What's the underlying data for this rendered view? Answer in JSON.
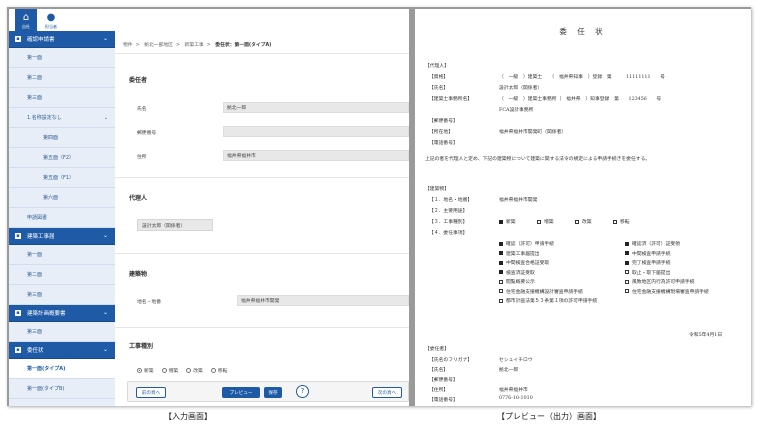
{
  "topbar": {
    "home_label": "自社",
    "user_label": "担当者"
  },
  "sidebar": {
    "groups": [
      {
        "title": "確認申請書",
        "items": [
          {
            "label": "第一面",
            "level": 1
          },
          {
            "label": "第二面",
            "level": 1
          },
          {
            "label": "第三面",
            "level": 1
          },
          {
            "label": "1.名称設定なし",
            "level": 1,
            "has_chevron": true
          },
          {
            "label": "第四面",
            "level": 2
          },
          {
            "label": "第五面（F2）",
            "level": 2
          },
          {
            "label": "第五面（F1）",
            "level": 2
          },
          {
            "label": "第六面",
            "level": 2
          },
          {
            "label": "申請図書",
            "level": 1
          }
        ]
      },
      {
        "title": "建築工事届",
        "items": [
          {
            "label": "第一面",
            "level": 1
          },
          {
            "label": "第二面",
            "level": 1
          },
          {
            "label": "第三面",
            "level": 1
          }
        ]
      },
      {
        "title": "建築計画概要書",
        "items": [
          {
            "label": "第三面",
            "level": 1
          }
        ]
      },
      {
        "title": "委任状",
        "items": [
          {
            "label": "第一面(タイプA)",
            "level": 1,
            "active": true
          },
          {
            "label": "第一面(タイプB)",
            "level": 1
          }
        ]
      }
    ]
  },
  "breadcrumb": {
    "items": [
      "物件",
      "拠北一部地区",
      "新築工事",
      "委任状：第一面(タイプA)"
    ]
  },
  "form": {
    "principal": {
      "title": "委任者",
      "name_label": "氏名",
      "name_value": "拠北一郎",
      "postal_label": "郵便番号",
      "postal_value": "",
      "address_label": "住所",
      "address_value": "福井県福井市"
    },
    "agent": {
      "title": "代理人",
      "value": "設計太郎（関係者）"
    },
    "building": {
      "title": "建築物",
      "location_label": "地名・地番",
      "location_value": "福井県福井市開発"
    },
    "work_type": {
      "title": "工事種別",
      "options": [
        "新築",
        "増築",
        "改築",
        "移転"
      ],
      "selected": "新築"
    }
  },
  "actions": {
    "prev_label": "前の頁へ",
    "preview_label": "プレビュー",
    "save_label": "保存",
    "help_label": "?",
    "next_label": "次の頁へ"
  },
  "preview": {
    "title": "委 任 状",
    "agent_header": "【代理人】",
    "agent_rows": [
      {
        "label": "【資格】",
        "value": "（　一級　）建築士　　（　福井県知事　）登録　第　　　11111111　　号"
      },
      {
        "label": "【氏名】",
        "value": "設計太郎（関係者）"
      },
      {
        "label": "【建築士事務所名】",
        "value": "（　一級　）建築士事務所（　福井県　）知事登録　第　　123456　　号"
      },
      {
        "label": "",
        "value": "FCA設計事務所"
      },
      {
        "label": "【郵便番号】",
        "value": ""
      },
      {
        "label": "【所在地】",
        "value": "福井県福井市開発町（関係者）"
      },
      {
        "label": "【電話番号】",
        "value": ""
      }
    ],
    "statement": "上記の者を代理人と定め、下記の建築物について建築に関する法令の規定による申請手続きを委任する。",
    "building_header": "【建築物】",
    "building_rows": [
      {
        "label": "【１．地名・地番】",
        "value": "福井県福井市開発"
      },
      {
        "label": "【２．主要用途】",
        "value": ""
      },
      {
        "label": "【３．工事種別】",
        "value": ""
      },
      {
        "label": "【４．委任事項】",
        "value": ""
      }
    ],
    "work_types": [
      {
        "label": "新築",
        "checked": true
      },
      {
        "label": "増築",
        "checked": false
      },
      {
        "label": "改築",
        "checked": false
      },
      {
        "label": "移転",
        "checked": false
      }
    ],
    "delegation_left": [
      {
        "label": "確認（許可）申請手続",
        "checked": true
      },
      {
        "label": "建築工事届提出",
        "checked": true
      },
      {
        "label": "中間検査合格証受取",
        "checked": true
      },
      {
        "label": "検査済証受取",
        "checked": true
      },
      {
        "label": "閲覧概要公示",
        "checked": false
      },
      {
        "label": "住宅金融支援機構設計審査申請手続",
        "checked": false
      },
      {
        "label": "都市計画法第５３条第１項の許可申請手続",
        "checked": false
      }
    ],
    "delegation_right": [
      {
        "label": "確認済（許可）証受領",
        "checked": true
      },
      {
        "label": "中間検査申請手続",
        "checked": true
      },
      {
        "label": "完了検査申請手続",
        "checked": true
      },
      {
        "label": "取止・取下届提出",
        "checked": false
      },
      {
        "label": "風致地区内行為許可申請手続",
        "checked": false
      },
      {
        "label": "住宅金融支援機構現場審査申請手続",
        "checked": false
      }
    ],
    "date": "令和5年4月1日",
    "principal_header": "【委任者】",
    "principal_rows": [
      {
        "label": "【氏名のフリガナ】",
        "value": "セシュイチロウ"
      },
      {
        "label": "【氏名】",
        "value": "拠北一郎"
      },
      {
        "label": "【郵便番号】",
        "value": ""
      },
      {
        "label": "【住所】",
        "value": "福井県福井市"
      },
      {
        "label": "【電話番号】",
        "value": "0776-10-1010"
      }
    ]
  },
  "captions": {
    "input": "【入力画面】",
    "preview": "【プレビュー（出力）画面】"
  }
}
